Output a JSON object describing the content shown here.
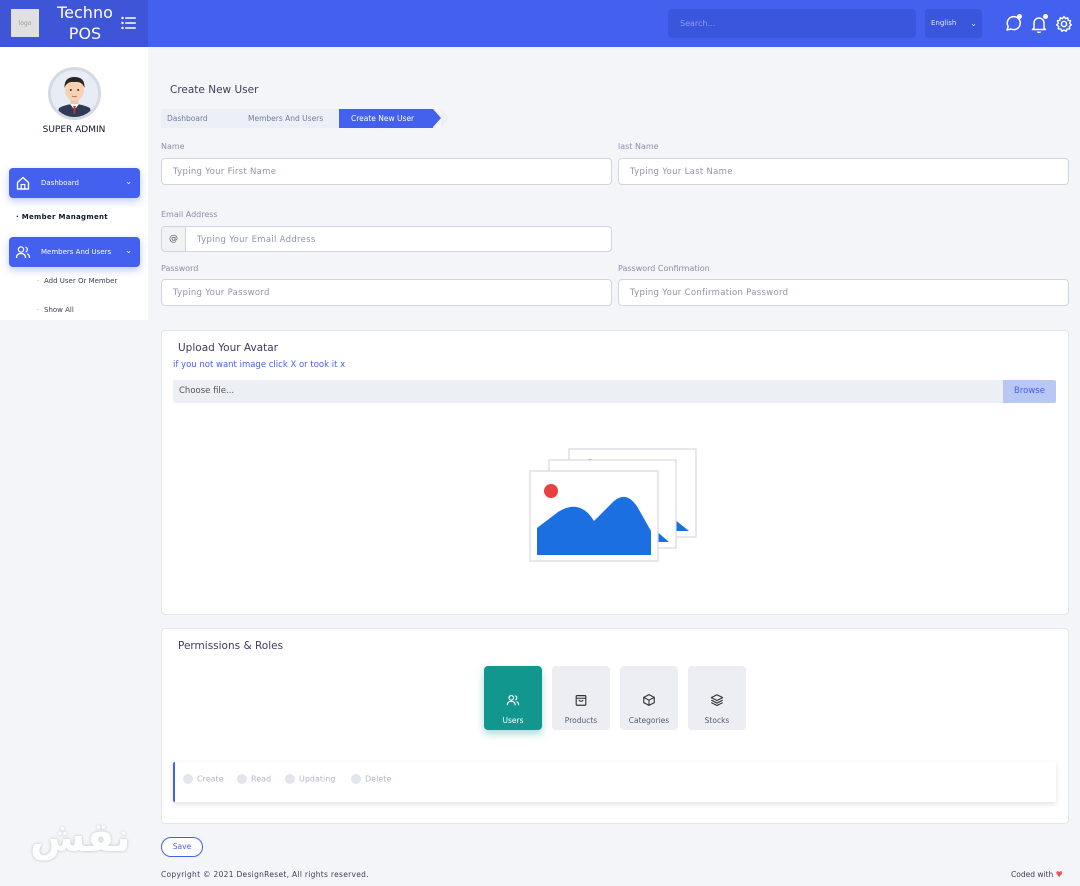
{
  "app": {
    "logo_text": "logo",
    "title_line1": "Techno",
    "title_line2": "POS"
  },
  "header": {
    "search_placeholder": "Search...",
    "language": "English"
  },
  "sidebar": {
    "role": "SUPER ADMIN",
    "dashboard_label": "Dashboard",
    "section_heading": "Member Managment",
    "members_label": "Members And Users",
    "sub_items": [
      "Add User Or Member",
      "Show All"
    ]
  },
  "page": {
    "title": "Create New User",
    "breadcrumb": [
      "Dashboard",
      "Members And Users",
      "Create New User"
    ]
  },
  "form": {
    "name_label": "Name",
    "first_name_placeholder": "Typing Your First Name",
    "last_name_label": "last Name",
    "last_name_placeholder": "Typing Your Last Name",
    "email_label": "Email Address",
    "email_prefix": "@",
    "email_placeholder": "Typing Your Email Address",
    "password_label": "Password",
    "password_placeholder": "Typing Your Password",
    "confirm_label": "Password Confirmation",
    "confirm_placeholder": "Typing Your Confirmation Password"
  },
  "avatar_card": {
    "title": "Upload Your Avatar",
    "hint": "if you not want image click X or took it x",
    "file_placeholder": "Choose file...",
    "browse_label": "Browse"
  },
  "permissions": {
    "title": "Permissions & Roles",
    "categories": [
      {
        "label": "Users",
        "icon": "users-icon",
        "active": true
      },
      {
        "label": "Products",
        "icon": "bag-icon",
        "active": false
      },
      {
        "label": "Categories",
        "icon": "box-icon",
        "active": false
      },
      {
        "label": "Stocks",
        "icon": "layers-icon",
        "active": false
      }
    ],
    "actions": [
      "Create",
      "Read",
      "Updating",
      "Delete"
    ]
  },
  "footer": {
    "save_label": "Save",
    "copyright": "Copyright © 2021 DesignReset, All rights reserved.",
    "coded_with": "Coded with"
  },
  "colors": {
    "primary": "#4361ee",
    "teal": "#12978e"
  }
}
